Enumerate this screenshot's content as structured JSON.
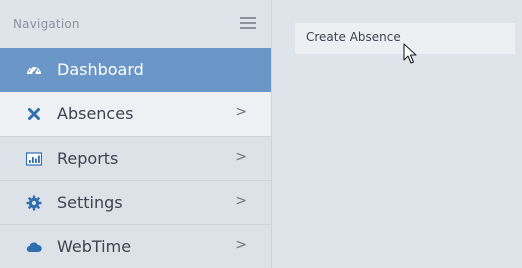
{
  "navigation": {
    "title": "Navigation",
    "menu_icon": "hamburger-icon",
    "items": [
      {
        "label": "Dashboard",
        "icon": "dashboard-icon",
        "active": true
      },
      {
        "label": "Absences",
        "icon": "close-x-icon",
        "chevron": ">"
      },
      {
        "label": "Reports",
        "icon": "bar-chart-icon",
        "chevron": ">"
      },
      {
        "label": "Settings",
        "icon": "gear-icon",
        "chevron": ">"
      },
      {
        "label": "WebTime",
        "icon": "cloud-icon",
        "chevron": ">"
      }
    ]
  },
  "submenu": {
    "items": [
      {
        "label": "Create Absence"
      }
    ]
  },
  "colors": {
    "accent": "#6a96c8",
    "icon_blue": "#2f6fb0",
    "sidebar_bg": "#dde1e8",
    "text": "#3c4450"
  }
}
